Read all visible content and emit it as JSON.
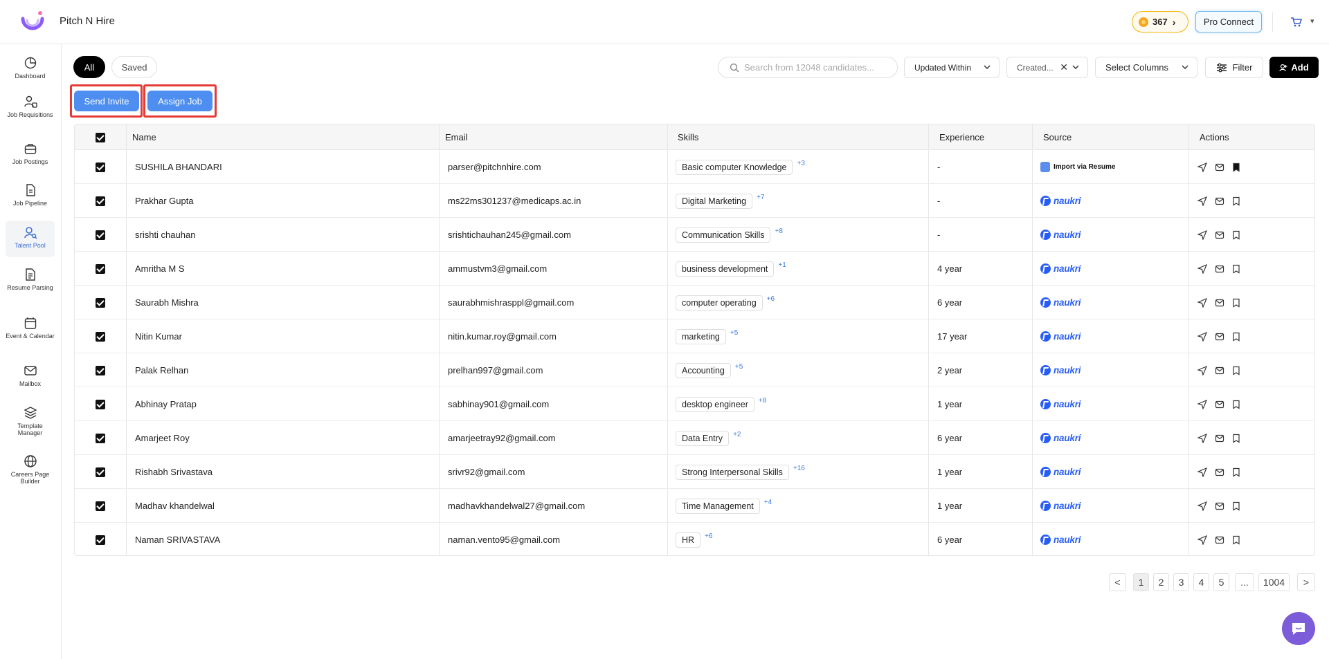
{
  "header": {
    "app_title": "Pitch N Hire",
    "coins": "367",
    "pro_connect": "Pro Connect"
  },
  "sidebar": {
    "items": [
      {
        "label": "Dashboard",
        "icon": "dashboard-icon"
      },
      {
        "label": "Job Requisitions",
        "icon": "requisition-icon"
      },
      {
        "label": "Job Postings",
        "icon": "briefcase-icon"
      },
      {
        "label": "Job Pipeline",
        "icon": "pipeline-icon"
      },
      {
        "label": "Talent Pool",
        "icon": "talent-icon",
        "active": true
      },
      {
        "label": "Resume Parsing",
        "icon": "resume-icon"
      },
      {
        "label": "Event & Calendar",
        "icon": "calendar-icon"
      },
      {
        "label": "Mailbox",
        "icon": "mail-icon"
      },
      {
        "label": "Template Manager",
        "icon": "layers-icon"
      },
      {
        "label": "Careers Page Builder",
        "icon": "globe-icon"
      }
    ]
  },
  "toolbar": {
    "tab_all": "All",
    "tab_saved": "Saved",
    "search_placeholder": "Search from 12048 candidates...",
    "updated_within": "Updated Within",
    "created": "Created...",
    "select_columns": "Select Columns",
    "filter": "Filter",
    "add": "Add",
    "send_invite": "Send Invite",
    "assign_job": "Assign Job"
  },
  "table": {
    "headers": [
      "Name",
      "Email",
      "Skills",
      "Experience",
      "Source",
      "Actions"
    ],
    "rows": [
      {
        "name": "SUSHILA BHANDARI",
        "email": "parser@pitchnhire.com",
        "skill": "Basic computer Knowledge",
        "more": "+3",
        "experience": "-",
        "source": "Import via Resume"
      },
      {
        "name": "Prakhar Gupta",
        "email": "ms22ms301237@medicaps.ac.in",
        "skill": "Digital Marketing",
        "more": "+7",
        "experience": "-",
        "source": "naukri"
      },
      {
        "name": "srishti chauhan",
        "email": "srishtichauhan245@gmail.com",
        "skill": "Communication Skills",
        "more": "+8",
        "experience": "-",
        "source": "naukri"
      },
      {
        "name": "Amritha M S",
        "email": "ammustvm3@gmail.com",
        "skill": "business development",
        "more": "+1",
        "experience": "4 year",
        "source": "naukri"
      },
      {
        "name": "Saurabh Mishra",
        "email": "saurabhmishrasppl@gmail.com",
        "skill": "computer operating",
        "more": "+6",
        "experience": "6 year",
        "source": "naukri"
      },
      {
        "name": "Nitin Kumar",
        "email": "nitin.kumar.roy@gmail.com",
        "skill": "marketing",
        "more": "+5",
        "experience": "17 year",
        "source": "naukri"
      },
      {
        "name": "Palak Relhan",
        "email": "prelhan997@gmail.com",
        "skill": "Accounting",
        "more": "+5",
        "experience": "2 year",
        "source": "naukri"
      },
      {
        "name": "Abhinay Pratap",
        "email": "sabhinay901@gmail.com",
        "skill": "desktop engineer",
        "more": "+8",
        "experience": "1 year",
        "source": "naukri"
      },
      {
        "name": "Amarjeet Roy",
        "email": "amarjeetray92@gmail.com",
        "skill": "Data Entry",
        "more": "+2",
        "experience": "6 year",
        "source": "naukri"
      },
      {
        "name": "Rishabh Srivastava",
        "email": "srivr92@gmail.com",
        "skill": "Strong Interpersonal Skills",
        "more": "+16",
        "experience": "1 year",
        "source": "naukri"
      },
      {
        "name": "Madhav khandelwal",
        "email": "madhavkhandelwal27@gmail.com",
        "skill": "Time Management",
        "more": "+4",
        "experience": "1 year",
        "source": "naukri"
      },
      {
        "name": "Naman SRIVASTAVA",
        "email": "naman.vento95@gmail.com",
        "skill": "HR",
        "more": "+6",
        "experience": "6 year",
        "source": "naukri"
      }
    ]
  },
  "pagination": {
    "prev": "<",
    "pages": [
      "1",
      "2",
      "3",
      "4",
      "5",
      "...",
      "1004"
    ],
    "next": ">",
    "current": "1"
  },
  "colors": {
    "accent": "#4d8ef0",
    "highlight": "#e53935",
    "naukri": "#2a5ff5",
    "coin_border": "#f5b400",
    "chat": "#7c5cd8"
  }
}
